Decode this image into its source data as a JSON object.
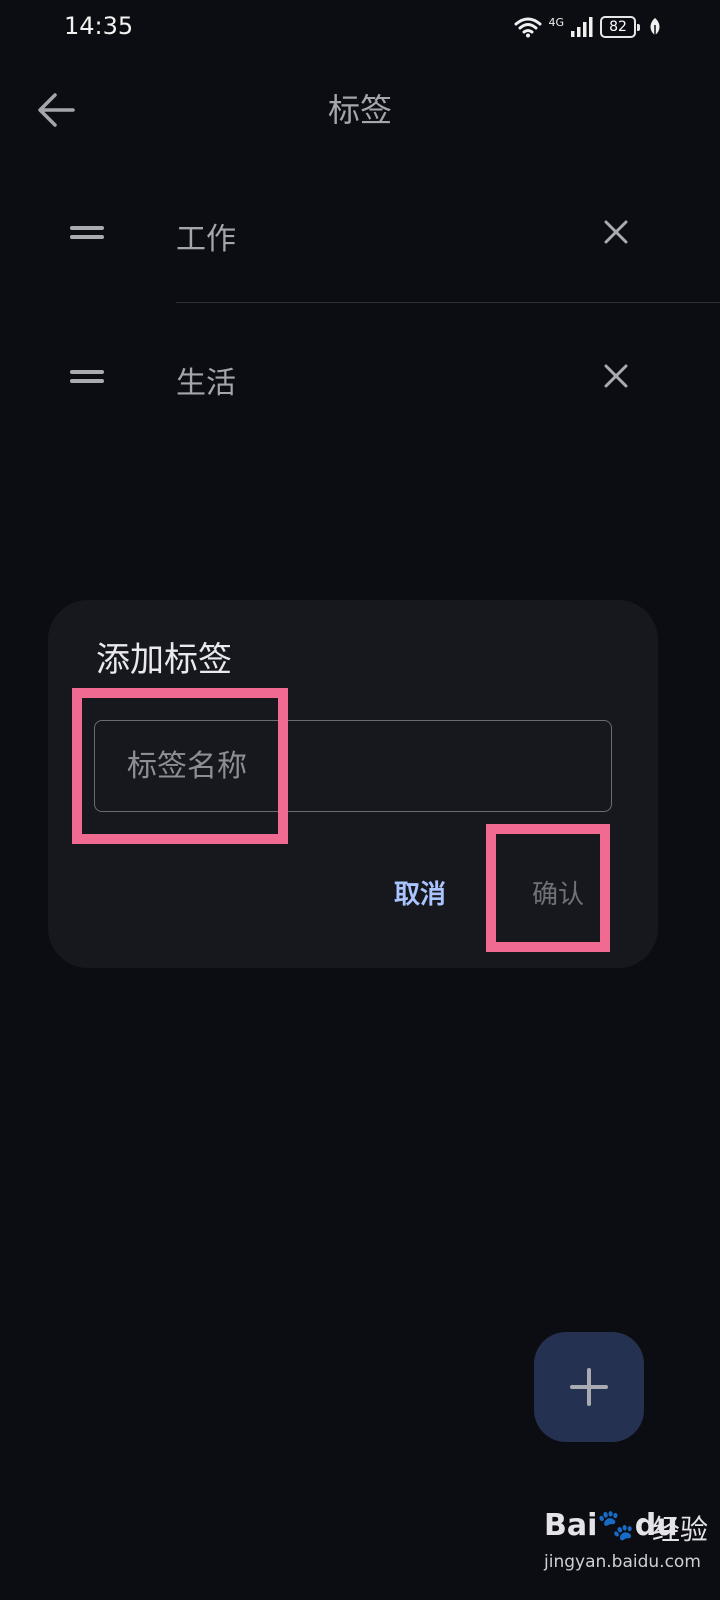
{
  "status_bar": {
    "time": "14:35",
    "network": "4G",
    "battery": "82",
    "icons": [
      "wifi-icon",
      "signal-icon",
      "battery-icon",
      "leaf-icon"
    ]
  },
  "app_bar": {
    "title": "标签",
    "back_icon": "arrow-left-icon"
  },
  "tags": [
    {
      "label": "工作",
      "drag_icon": "drag-handle-icon",
      "delete_icon": "close-icon"
    },
    {
      "label": "生活",
      "drag_icon": "drag-handle-icon",
      "delete_icon": "close-icon"
    }
  ],
  "dialog": {
    "title": "添加标签",
    "input_placeholder": "标签名称",
    "input_value": "",
    "cancel_label": "取消",
    "confirm_label": "确认"
  },
  "fab": {
    "icon": "plus-icon"
  },
  "watermark": {
    "logo": "Bai",
    "logo_suffix": "du",
    "jingyan": "经验",
    "url": "jingyan.baidu.com"
  },
  "colors": {
    "background": "#0c0d12",
    "dialog": "#17181e",
    "accent": "#a9c4ff",
    "highlight": "#f06a92",
    "fab": "#243150"
  }
}
